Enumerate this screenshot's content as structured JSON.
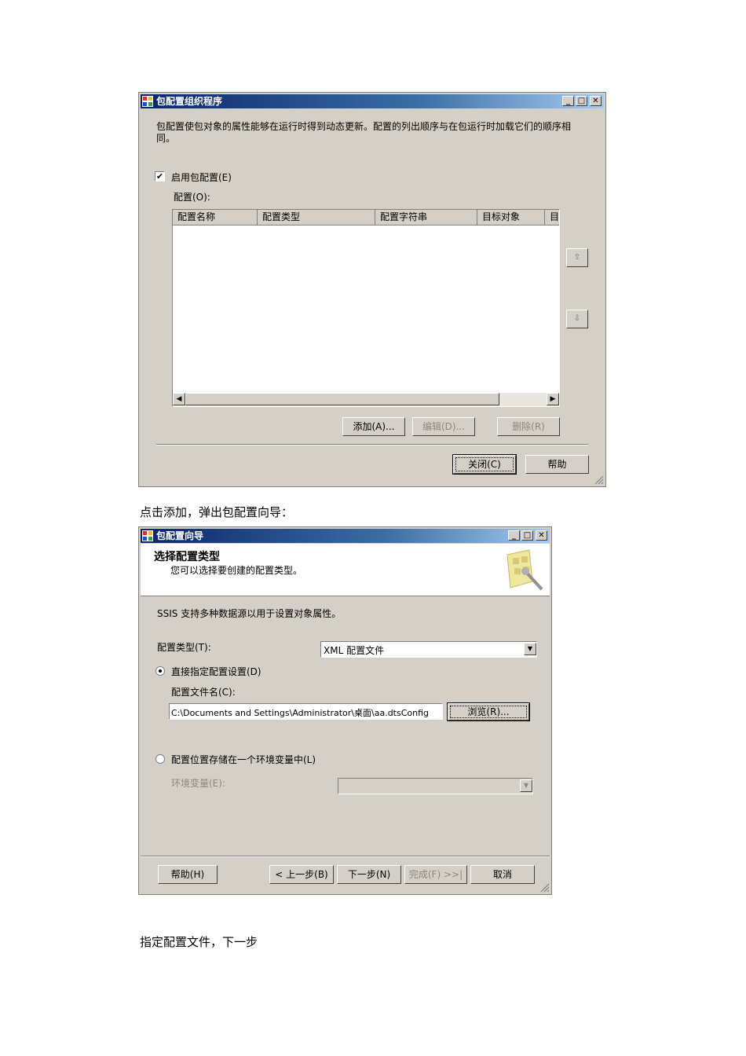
{
  "window1": {
    "title": "包配置组织程序",
    "description": "包配置使包对象的属性能够在运行时得到动态更新。配置的列出顺序与在包运行时加载它们的顺序相同。",
    "enable_label": "启用包配置(E)",
    "enable_checked": true,
    "configs_label": "配置(O):",
    "columns": [
      "配置名称",
      "配置类型",
      "配置字符串",
      "目标对象",
      "目"
    ],
    "add_button": "添加(A)...",
    "edit_button": "编辑(D)...",
    "delete_button": "删除(R)",
    "close_button": "关闭(C)",
    "help_button": "帮助"
  },
  "caption1": "点击添加，弹出包配置向导：",
  "window2": {
    "title": "包配置向导",
    "header_title": "选择配置类型",
    "header_subtitle": "您可以选择要创建的配置类型。",
    "intro": "SSIS 支持多种数据源以用于设置对象属性。",
    "type_label": "配置类型(T):",
    "type_value": "XML 配置文件",
    "radio1_label": "直接指定配置设置(D)",
    "radio1_selected": true,
    "filename_label": "配置文件名(C):",
    "filename_value": "C:\\Documents and Settings\\Administrator\\桌面\\aa.dtsConfig",
    "browse_button": "浏览(R)...",
    "radio2_label": "配置位置存储在一个环境变量中(L)",
    "radio2_selected": false,
    "envvar_label": "环境变量(E):",
    "help_button": "帮助(H)",
    "back_button": "< 上一步(B)",
    "next_button": "下一步(N)",
    "finish_button": "完成(F) >>|",
    "cancel_button": "取消"
  },
  "caption2": "指定配置文件，下一步",
  "colors": {
    "titlebar_start": "#0a246a",
    "titlebar_end": "#a6caf0",
    "dialog_bg": "#d4d0c8"
  }
}
